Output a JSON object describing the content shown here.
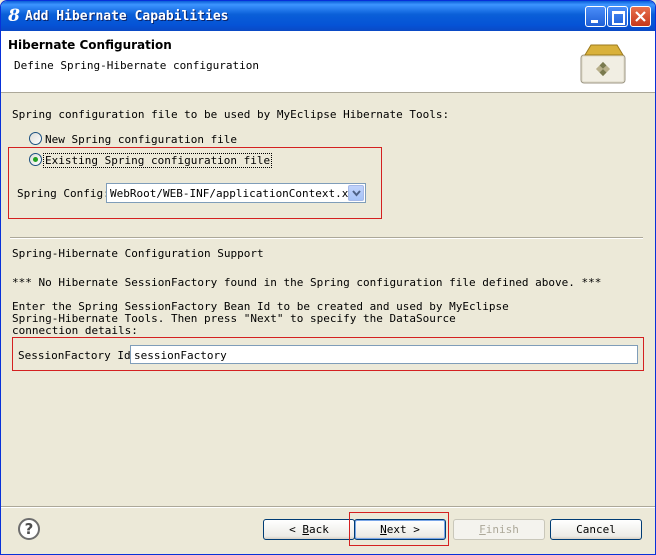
{
  "window": {
    "title": "Add Hibernate Capabilities"
  },
  "header": {
    "title": "Hibernate Configuration",
    "description": "Define Spring-Hibernate configuration"
  },
  "spring_config_section": {
    "label": "Spring configuration file to be used by MyEclipse Hibernate Tools:",
    "radio_new": {
      "label": "New Spring configuration file",
      "selected": false
    },
    "radio_existing": {
      "label": "Existing Spring configuration file",
      "selected": true
    },
    "spring_config_label": "Spring Config:",
    "spring_config_value": "WebRoot/WEB-INF/applicationContext.xml"
  },
  "support_section": {
    "heading": "Spring-Hibernate Configuration Support",
    "warning": "*** No Hibernate SessionFactory found in the Spring configuration file defined above. ***",
    "instructions": [
      "Enter the Spring SessionFactory Bean Id to be created and used by MyEclipse",
      "Spring-Hibernate Tools. Then press \"Next\" to specify the DataSource",
      "connection details:"
    ],
    "session_factory_label": "SessionFactory Id:",
    "session_factory_value": "sessionFactory"
  },
  "footer": {
    "back": {
      "mnemonic": "B",
      "rest": "ack",
      "prefix": "< "
    },
    "next": {
      "mnemonic": "N",
      "rest": "ext",
      "suffix": " >"
    },
    "finish": {
      "mnemonic": "F",
      "rest": "inish"
    },
    "cancel": "Cancel"
  },
  "colors": {
    "titlebar": "#0a5fd8",
    "highlight_box": "#d42020",
    "dialog_bg": "#ece9d8"
  }
}
